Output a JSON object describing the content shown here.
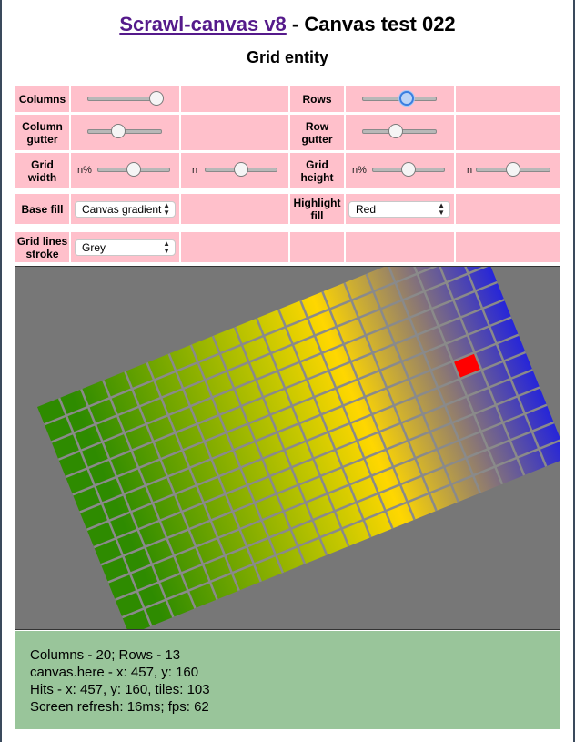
{
  "header": {
    "link_text": "Scrawl-canvas v8",
    "title_rest": " - Canvas test 022",
    "subtitle": "Grid entity"
  },
  "controls": {
    "columns": {
      "label": "Columns",
      "value_fraction": 0.93
    },
    "rows": {
      "label": "Rows",
      "value_fraction": 0.6
    },
    "column_gutter": {
      "label": "Column gutter",
      "value_fraction": 0.41
    },
    "row_gutter": {
      "label": "Row gutter",
      "value_fraction": 0.45
    },
    "grid_width": {
      "label": "Grid width",
      "percent_prefix": "n%",
      "percent_value_fraction": 0.5,
      "number_prefix": "n",
      "number_value_fraction": 0.5
    },
    "grid_height": {
      "label": "Grid height",
      "percent_prefix": "n%",
      "percent_value_fraction": 0.5,
      "number_prefix": "n",
      "number_value_fraction": 0.5
    },
    "base_fill": {
      "label": "Base fill",
      "selected": "Canvas gradient"
    },
    "highlight_fill": {
      "label": "Highlight fill",
      "selected": "Red"
    },
    "grid_lines_stroke": {
      "label": "Grid lines stroke",
      "selected": "Grey"
    }
  },
  "canvas": {
    "background_color": "#777777",
    "columns": 20,
    "rows": 13,
    "rotation_deg": -22,
    "line_color": "#8a8a8a",
    "highlight_color": "#ff0000",
    "highlight_cell": {
      "column": 17,
      "row": 6
    },
    "gradient_stops": [
      "#2e8b00",
      "#c8c800",
      "#ffd700",
      "#2222dd"
    ]
  },
  "report": {
    "line1": "Columns - 20; Rows - 13",
    "line2": "canvas.here - x: 457, y: 160",
    "line3": "Hits - x: 457, y: 160, tiles: 103",
    "line4": "Screen refresh: 16ms; fps: 62"
  }
}
